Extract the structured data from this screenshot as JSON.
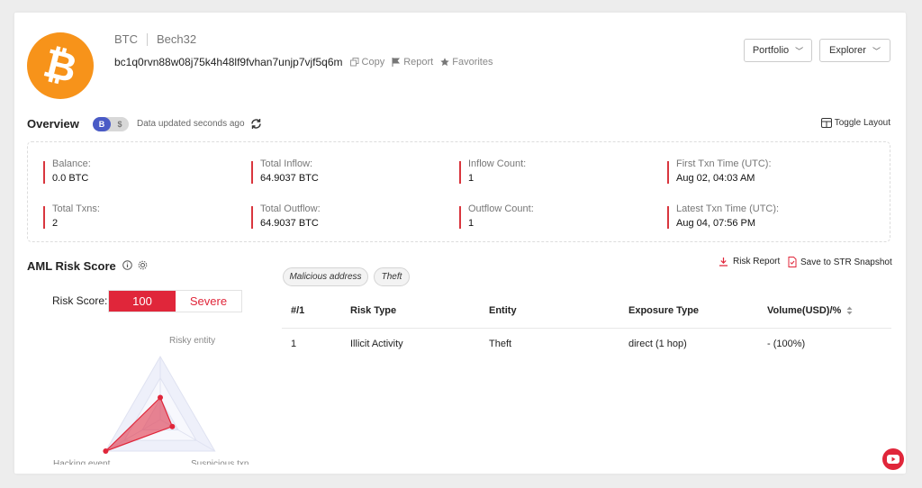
{
  "header": {
    "logo_symbol": "₿",
    "chain": "BTC",
    "address_type": "Bech32",
    "address": "bc1q0rvn88w08j75k4h48lf9fvhan7unjp7vjf5q6m",
    "actions": {
      "copy": "Copy",
      "report": "Report",
      "favorites": "Favorites"
    },
    "portfolio_label": "Portfolio",
    "explorer_label": "Explorer"
  },
  "overview": {
    "title": "Overview",
    "currency_on": "B",
    "currency_off": "$",
    "updated_text": "Data updated seconds ago",
    "toggle_layout": "Toggle Layout",
    "stats": [
      {
        "label": "Balance:",
        "value": "0.0 BTC"
      },
      {
        "label": "Total Inflow:",
        "value": "64.9037 BTC"
      },
      {
        "label": "Inflow Count:",
        "value": "1"
      },
      {
        "label": "First Txn Time (UTC):",
        "value": "Aug 02, 04:03 AM"
      },
      {
        "label": "Total Txns:",
        "value": "2"
      },
      {
        "label": "Total Outflow:",
        "value": "64.9037 BTC"
      },
      {
        "label": "Outflow Count:",
        "value": "1"
      },
      {
        "label": "Latest Txn Time (UTC):",
        "value": "Aug 04, 07:56 PM"
      }
    ]
  },
  "aml": {
    "title": "AML Risk Score",
    "risk_score_label": "Risk Score:",
    "risk_score_value": "100",
    "risk_level": "Severe",
    "tags": [
      "Malicious address",
      "Theft"
    ],
    "risk_report_label": "Risk Report",
    "str_snapshot_label": "Save to STR Snapshot",
    "radar": {
      "axes": [
        "Risky entity",
        "Suspicious txn",
        "Hacking event"
      ],
      "values": [
        0.35,
        0.22,
        1.0
      ],
      "accent": "#e0263a"
    },
    "table": {
      "headers": [
        "#/1",
        "Risk Type",
        "Entity",
        "Exposure Type",
        "Volume(USD)/%"
      ],
      "rows": [
        [
          "1",
          "Illicit Activity",
          "Theft",
          "direct (1 hop)",
          "- (100%)"
        ]
      ]
    }
  },
  "colors": {
    "accent": "#e0263a",
    "bitcoin": "#f7931a",
    "toggle_on": "#4a5bc6"
  }
}
